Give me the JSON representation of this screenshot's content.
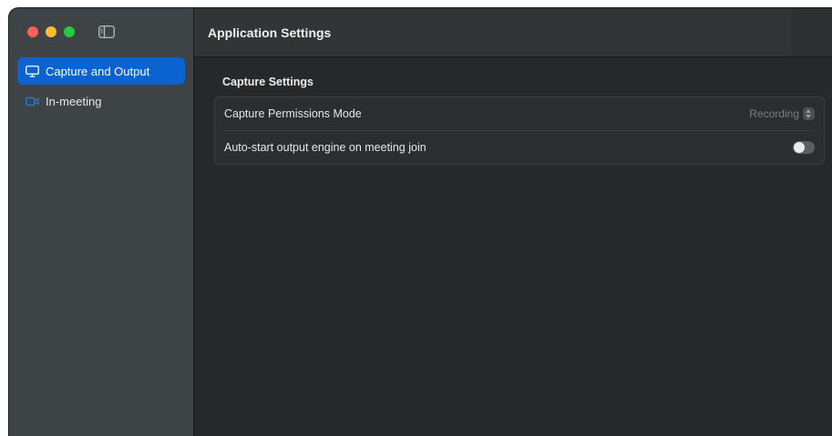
{
  "window": {
    "title": "Application Settings"
  },
  "sidebar": {
    "items": [
      {
        "label": "Capture and Output",
        "icon": "monitor-icon",
        "active": true
      },
      {
        "label": "In-meeting",
        "icon": "video-camera-icon",
        "active": false
      }
    ]
  },
  "capture_settings": {
    "heading": "Capture Settings",
    "permissions_mode": {
      "label": "Capture Permissions Mode",
      "value": "Recording"
    },
    "auto_start": {
      "label": "Auto-start output engine on meeting join",
      "enabled": false
    }
  },
  "colors": {
    "accent": "#0a63d1",
    "sidebar_bg": "#3e4446",
    "content_bg": "#262829",
    "close": "#fe5f57",
    "minimize": "#febc2e",
    "zoom": "#28c840"
  }
}
